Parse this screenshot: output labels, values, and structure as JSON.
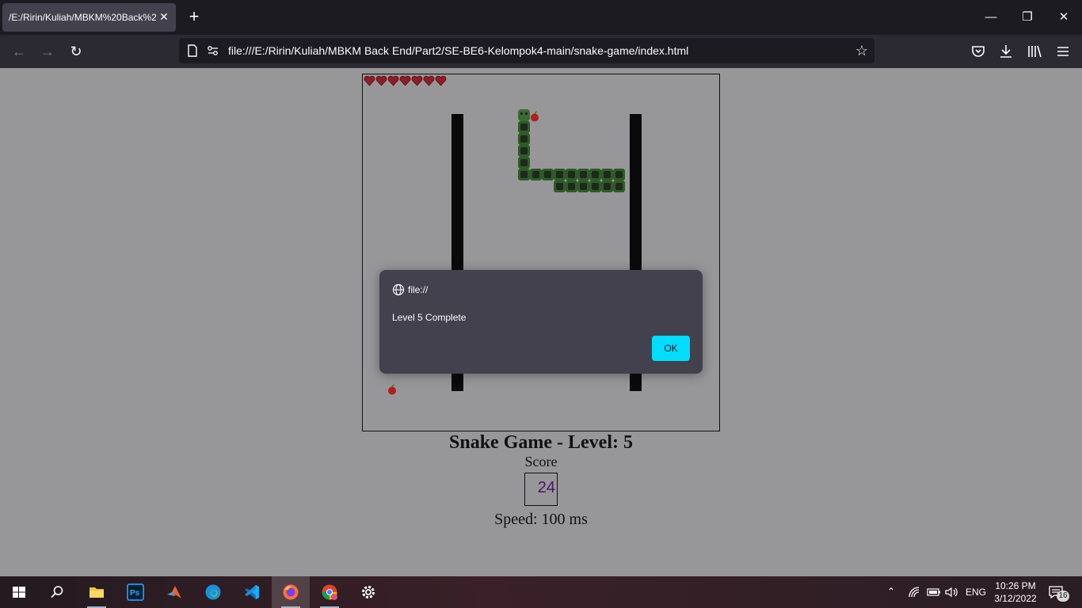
{
  "browser": {
    "tab_title": "/E:/Ririn/Kuliah/MBKM%20Back%2",
    "url": "file:///E:/Ririn/Kuliah/MBKM Back End/Part2/SE-BE6-Kelompok4-main/snake-game/index.html"
  },
  "game": {
    "lives": 7,
    "title": "Snake Game - Level: 5",
    "score_label": "Score",
    "score": "24",
    "speed": "Speed: 100 ms"
  },
  "dialog": {
    "origin": "file://",
    "message": "Level 5 Complete",
    "ok_label": "OK"
  },
  "taskbar": {
    "lang": "ENG",
    "time": "10:26 PM",
    "date": "3/12/2022",
    "notifications": "16"
  },
  "colors": {
    "snake": "#2f5a28",
    "dialog_button": "#00ddff",
    "score_text": "#4a1561"
  }
}
